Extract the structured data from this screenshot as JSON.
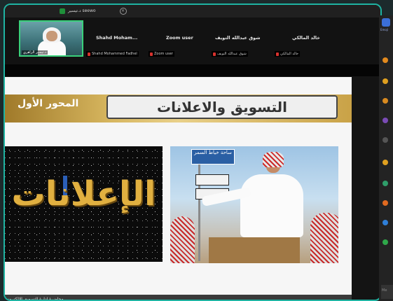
{
  "window": {
    "tab_title": "د.تيسير seewo"
  },
  "gallery": {
    "self": {
      "name": "د.تيسير الزاهري"
    },
    "participants": [
      {
        "name": "Shahd Moham...",
        "label": "Shahd Mohammed Fadhel"
      },
      {
        "name": "Zoom user",
        "label": "Zoom user"
      },
      {
        "name": "شوق عبدالله التويف",
        "label": "شوق عبدالله التويف"
      },
      {
        "name": "خالد المالكي",
        "label": "خالد المالكي"
      }
    ]
  },
  "slide": {
    "title": "التسويق والاعلانات",
    "axis": "المحور الأول",
    "left_image_text": "الإعلانات",
    "road_sign_text": "ساحة خياط السمر",
    "footer": "محاضرة ادارة التسويق الالكتروني"
  },
  "side_panel": {
    "label": "Emoji",
    "input_placeholder": "Me"
  },
  "colors": {
    "accent": "#1fb3a2",
    "gold": "#d6b55e",
    "mic_off": "#d8322e",
    "frame": "#3ad07a"
  }
}
